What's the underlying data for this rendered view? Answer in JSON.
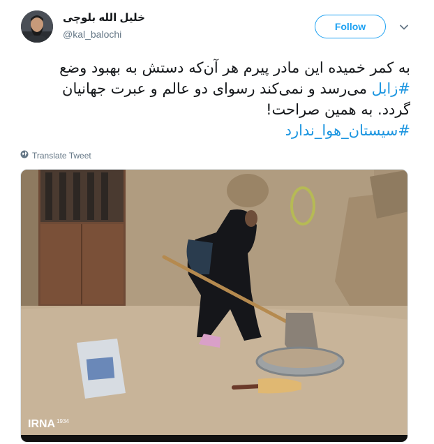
{
  "tweet": {
    "author": {
      "display_name": "خلیل الله بلوچی",
      "screen_name": "@kal_balochi"
    },
    "follow_label": "Follow",
    "text_lines": [
      {
        "plain": "به کمر خمیده این مادر پیرم هر آن‌که دستش به بهبود وضع",
        "hashtag": ""
      },
      {
        "hashtag": "#زابل",
        "plain": " می‌رسد و نمی‌کند رسوای دو عالم و عبرت جهانیان"
      },
      {
        "plain": "گردد. به همین صراحت!",
        "hashtag": ""
      },
      {
        "hashtag": "#سیستان_هوا_ندارد",
        "plain": ""
      }
    ],
    "translate_label": "Translate Tweet"
  },
  "media": {
    "watermark": "IRNA",
    "watermark_code": "1934"
  },
  "colors": {
    "accent": "#1da1f2",
    "hashtag": "#1b95e0",
    "secondary_text": "#657786"
  },
  "icons": {
    "menu": "chevron-down-icon",
    "translate": "globe-icon"
  }
}
